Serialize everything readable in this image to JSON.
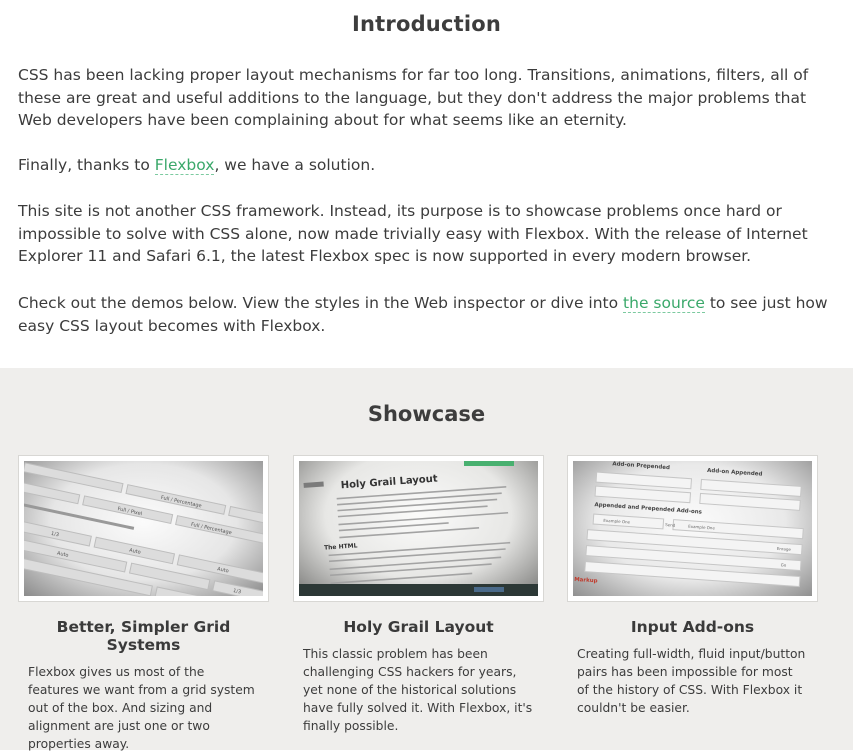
{
  "intro": {
    "heading": "Introduction",
    "p1": "CSS has been lacking proper layout mechanisms for far too long. Transitions, animations, filters, all of these are great and useful additions to the language, but they don't address the major problems that Web developers have been complaining about for what seems like an eternity.",
    "p2_before": "Finally, thanks to ",
    "p2_link": "Flexbox",
    "p2_after": ", we have a solution.",
    "p3": "This site is not another CSS framework. Instead, its purpose is to showcase problems once hard or impossible to solve with CSS alone, now made trivially easy with Flexbox. With the release of Internet Explorer 11 and Safari 6.1, the latest Flexbox spec is now supported in every modern browser.",
    "p4_before": "Check out the demos below. View the styles in the Web inspector or dive into ",
    "p4_link": "the source",
    "p4_after": " to see just how easy CSS layout becomes with Flexbox."
  },
  "showcase": {
    "heading": "Showcase",
    "cards": [
      {
        "title": "Better, Simpler Grid Systems",
        "text": "Flexbox gives us most of the features we want from a grid system out of the box. And sizing and alignment are just one or two properties away.",
        "thumb_labels": [
          "Full / Percentage",
          "Full / Percentage",
          "Full / Pixel",
          "1/3",
          "Auto",
          "Auto",
          "Auto",
          "1/3"
        ]
      },
      {
        "title": "Holy Grail Layout",
        "text": "This classic problem has been challenging CSS hackers for years, yet none of the historical solutions have fully solved it. With Flexbox, it's finally possible.",
        "thumb_labels": [
          "Holy Grail Layout",
          "The HTML"
        ]
      },
      {
        "title": "Input Add-ons",
        "text": "Creating full-width, fluid input/button pairs has been impossible for most of the history of CSS. With Flexbox it couldn't be easier.",
        "thumb_labels": [
          "Add-on Prepended",
          "Add-on Appended",
          "Appended and Prepended Add-ons",
          "Example One",
          "Example One",
          "Send",
          "Enrage",
          "Go",
          "Markup"
        ]
      }
    ]
  },
  "colors": {
    "link": "#3aa86a",
    "showcase_bg": "#efeeec",
    "text": "#3c3c3c"
  }
}
